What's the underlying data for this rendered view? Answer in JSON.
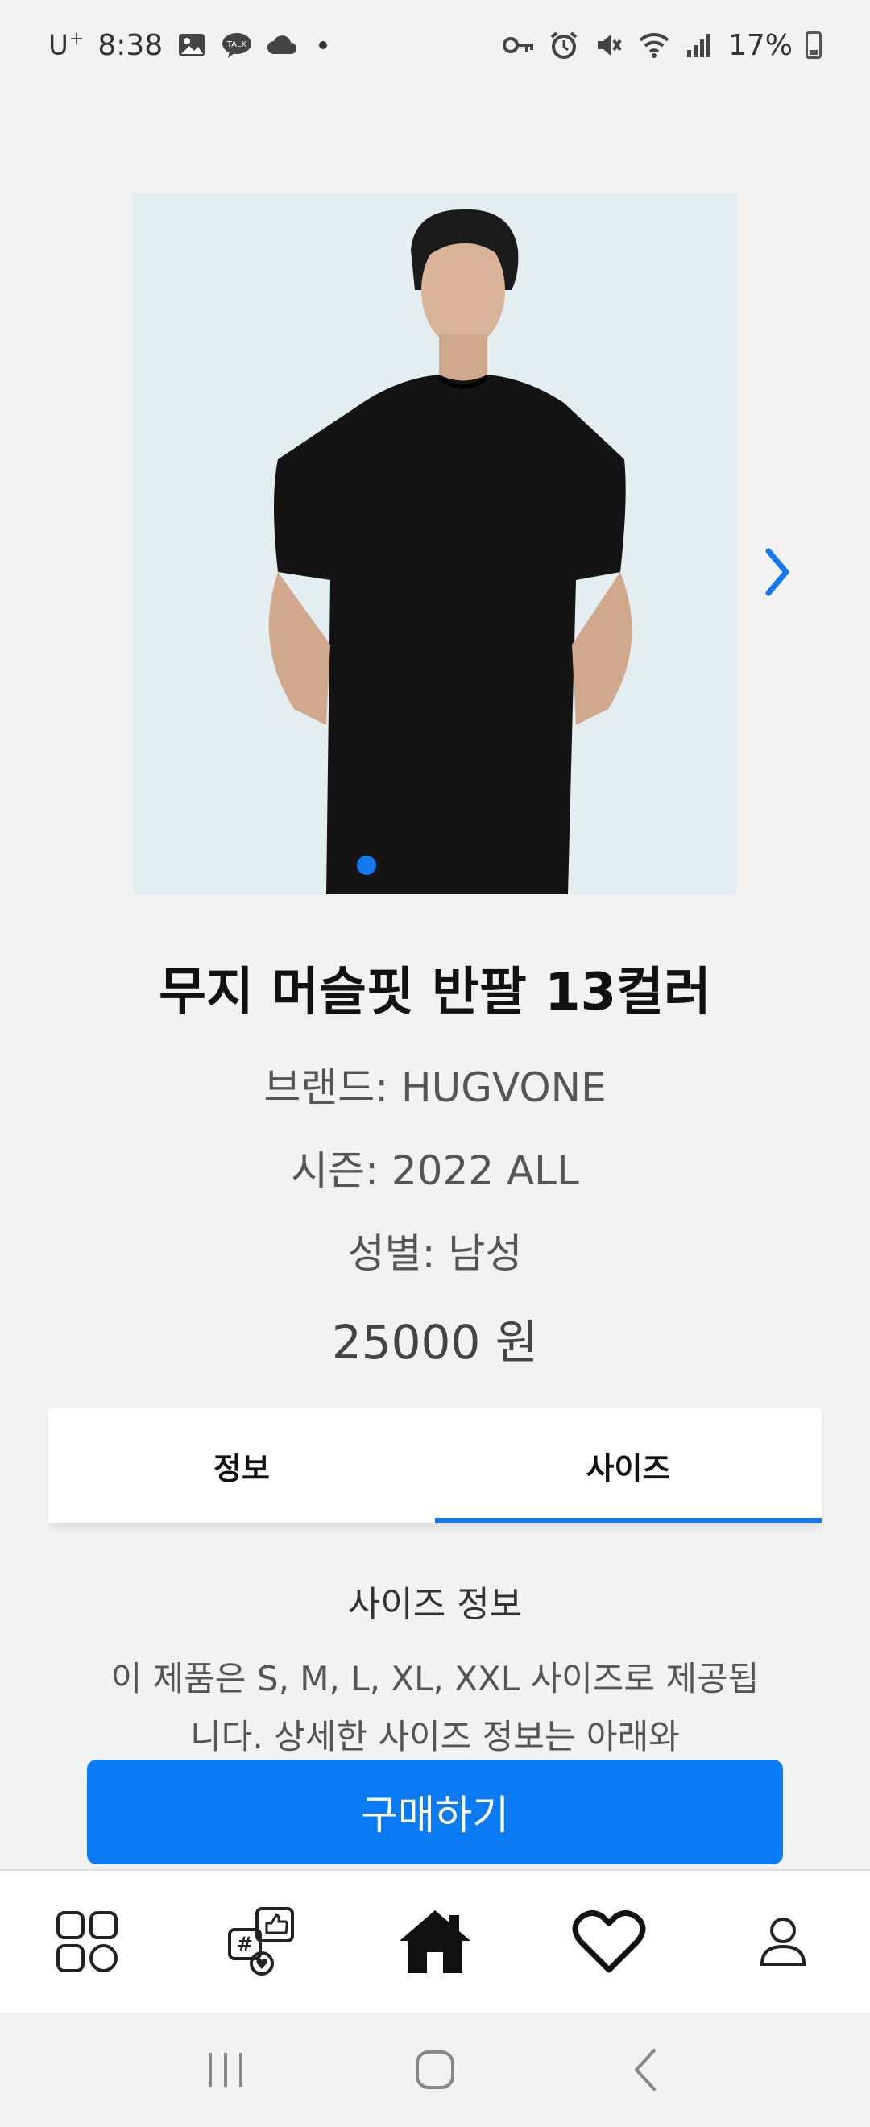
{
  "status_bar": {
    "carrier": "U",
    "carrier_suffix": "+",
    "time": "8:38",
    "battery": "17%",
    "icons": [
      "gallery-icon",
      "kakaotalk-icon",
      "cloud-icon",
      "key-icon",
      "alarm-icon",
      "mute-icon",
      "wifi-icon",
      "signal-icon",
      "battery-icon"
    ]
  },
  "carousel": {
    "image_alt": "black t-shirt model photo",
    "current_index": 1,
    "next_icon": "chevron-right-icon"
  },
  "product": {
    "title": "무지 머슬핏 반팔 13컬러",
    "brand_line": "브랜드: HUGVONE",
    "season_line": "시즌: 2022 ALL",
    "gender_line": "성별: 남성",
    "price_line": "25000 원"
  },
  "tabs": [
    {
      "label": "정보",
      "active": false
    },
    {
      "label": "사이즈",
      "active": true
    }
  ],
  "size_section": {
    "title": "사이즈 정보",
    "body": "이 제품은 S, M, L, XL, XXL 사이즈로 제공됩니다. 상세한 사이즈 정보는 아래와"
  },
  "buy_button": {
    "label": "구매하기"
  },
  "bottom_nav": [
    {
      "icon": "grid-icon"
    },
    {
      "icon": "community-icon"
    },
    {
      "icon": "home-icon"
    },
    {
      "icon": "heart-icon"
    },
    {
      "icon": "user-icon"
    }
  ],
  "system_nav": [
    "recents-icon",
    "home-circle-icon",
    "back-icon"
  ],
  "colors": {
    "accent": "#1478f0",
    "button": "#0b7bf5",
    "background": "#f2f2f2"
  }
}
